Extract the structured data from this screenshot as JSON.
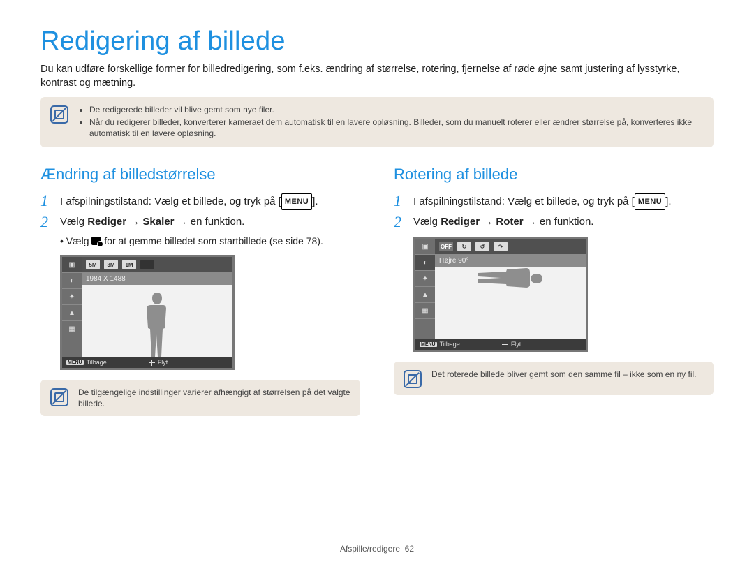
{
  "title": "Redigering af billede",
  "intro": "Du kan udføre forskellige former for billedredigering, som f.eks. ændring af størrelse, rotering, fjernelse af røde øjne samt justering af lysstyrke, kontrast og mætning.",
  "top_notes": [
    "De redigerede billeder vil blive gemt som nye filer.",
    "Når du redigerer billeder, konverterer kameraet dem automatisk til en lavere opløsning. Billeder, som du manuelt roterer eller ændrer størrelse på, konverteres ikke automatisk til en lavere opløsning."
  ],
  "left": {
    "heading": "Ændring af billedstørrelse",
    "step1_prefix": "I afspilningstilstand: Vælg et billede, og tryk på [",
    "step1_menu": "MENU",
    "step1_suffix": "].",
    "step2_prefix": "Vælg ",
    "step2_bold1": "Rediger",
    "step2_arrow1": " → ",
    "step2_bold2": "Skaler",
    "step2_arrow2": " → en funktion.",
    "substep_prefix": "Vælg ",
    "substep_suffix": " for at gemme billedet som startbillede (se side 78).",
    "lcd": {
      "topbar": [
        "5M",
        "3M",
        "1M",
        ""
      ],
      "sub": "1984 X 1488",
      "bottom_left_tag": "MENU",
      "bottom_left": "Tilbage",
      "bottom_right": "Flyt"
    },
    "bottom_note": "De tilgængelige indstillinger varierer afhængigt af størrelsen på det valgte billede."
  },
  "right": {
    "heading": "Rotering af billede",
    "step1_prefix": "I afspilningstilstand: Vælg et billede, og tryk på [",
    "step1_menu": "MENU",
    "step1_suffix": "].",
    "step2_prefix": "Vælg ",
    "step2_bold1": "Rediger",
    "step2_arrow1": " → ",
    "step2_bold2": "Roter",
    "step2_arrow2": " → en funktion.",
    "lcd": {
      "topbar": [
        "↻",
        "↺",
        "↷"
      ],
      "sub": "Højre 90°",
      "bottom_left_tag": "MENU",
      "bottom_left": "Tilbage",
      "bottom_right": "Flyt"
    },
    "bottom_note": "Det roterede billede bliver gemt som den samme fil – ikke som en ny fil."
  },
  "footer_section": "Afspille/redigere",
  "footer_page": "62"
}
